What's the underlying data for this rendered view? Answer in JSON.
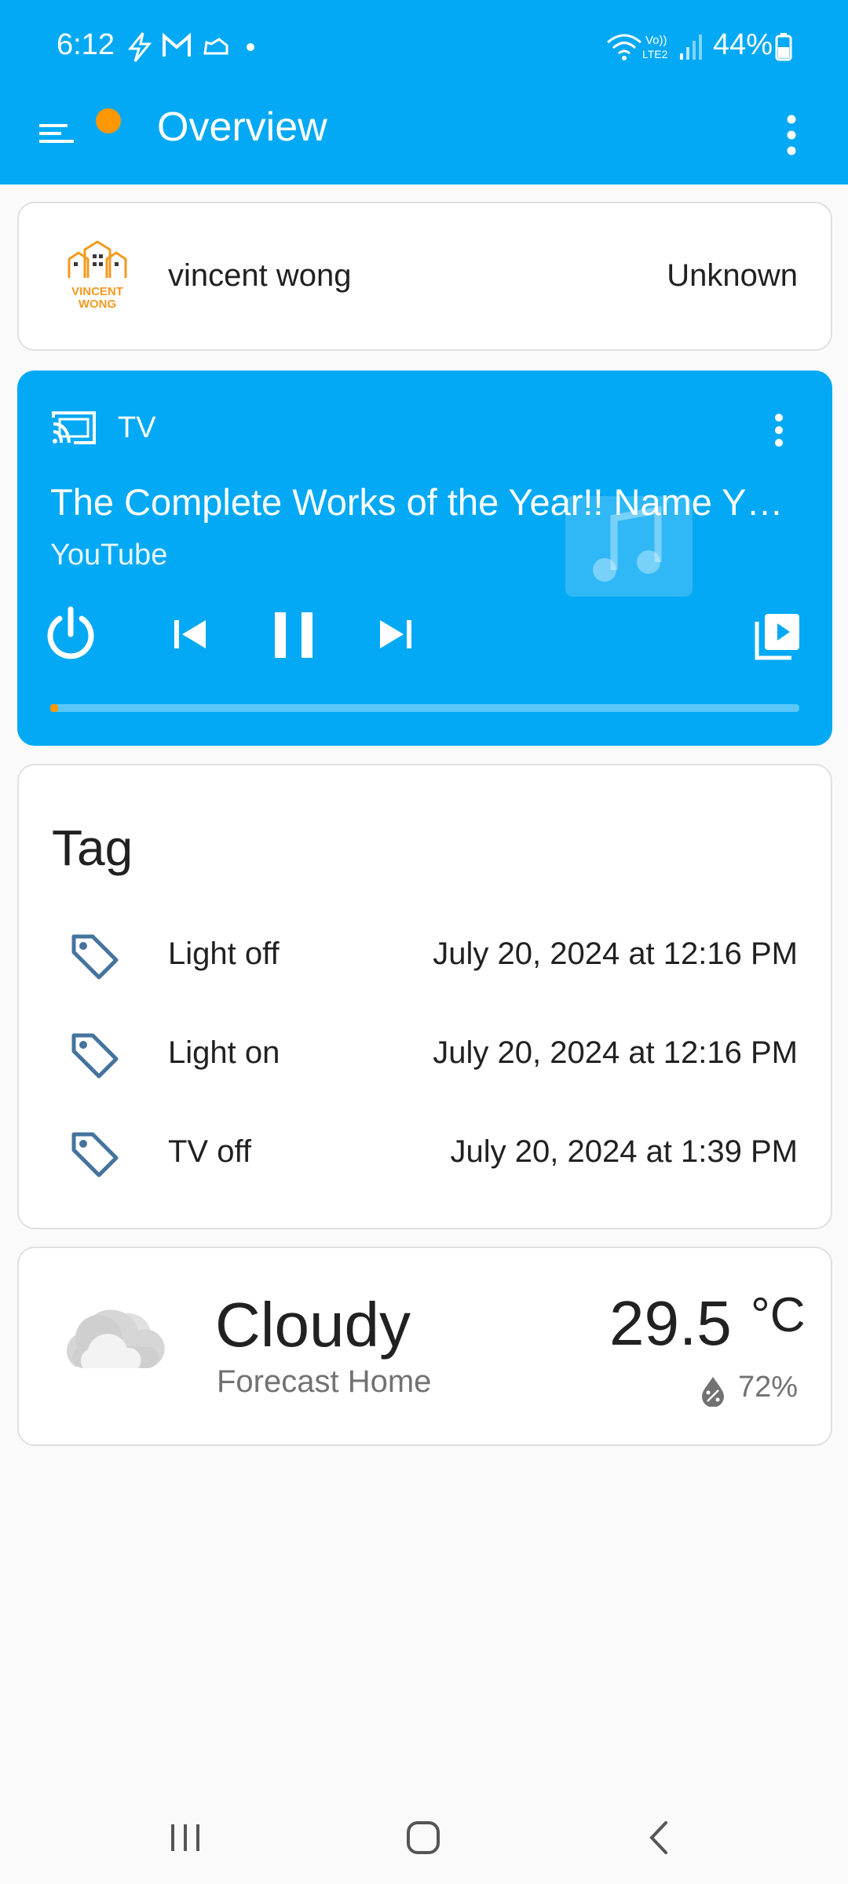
{
  "status_bar": {
    "time": "6:12",
    "battery": "44%",
    "icons": [
      "bolt-icon",
      "gmail-icon",
      "cloud-icon",
      "dot-icon",
      "wifi-icon",
      "volte-icon",
      "signal-icon",
      "battery-icon"
    ]
  },
  "header": {
    "title": "Overview",
    "menu_icon": "menu-icon",
    "more_icon": "more-vert-icon",
    "accent_color": "#03a9f4",
    "badge_color": "#ff9800"
  },
  "person_card": {
    "logo_text": "VINCENT WONG",
    "name": "vincent wong",
    "state": "Unknown"
  },
  "media_card": {
    "device": "TV",
    "title": "The Complete Works of the Year!! Name Y…",
    "app": "YouTube",
    "progress": 0.01,
    "controls": [
      "power-icon",
      "previous-icon",
      "pause-icon",
      "next-icon",
      "browse-media-icon"
    ]
  },
  "tag_card": {
    "heading": "Tag",
    "rows": [
      {
        "label": "Light off",
        "when": "July 20, 2024 at 12:16 PM"
      },
      {
        "label": "Light on",
        "when": "July 20, 2024 at 12:16 PM"
      },
      {
        "label": "TV off",
        "when": "July 20, 2024 at 1:39 PM"
      }
    ]
  },
  "weather_card": {
    "condition": "Cloudy",
    "location": "Forecast Home",
    "temperature": "29.5",
    "unit": "°C",
    "humidity": "72%"
  },
  "nav_bar": {
    "buttons": [
      "recents-icon",
      "home-icon",
      "back-icon"
    ]
  }
}
